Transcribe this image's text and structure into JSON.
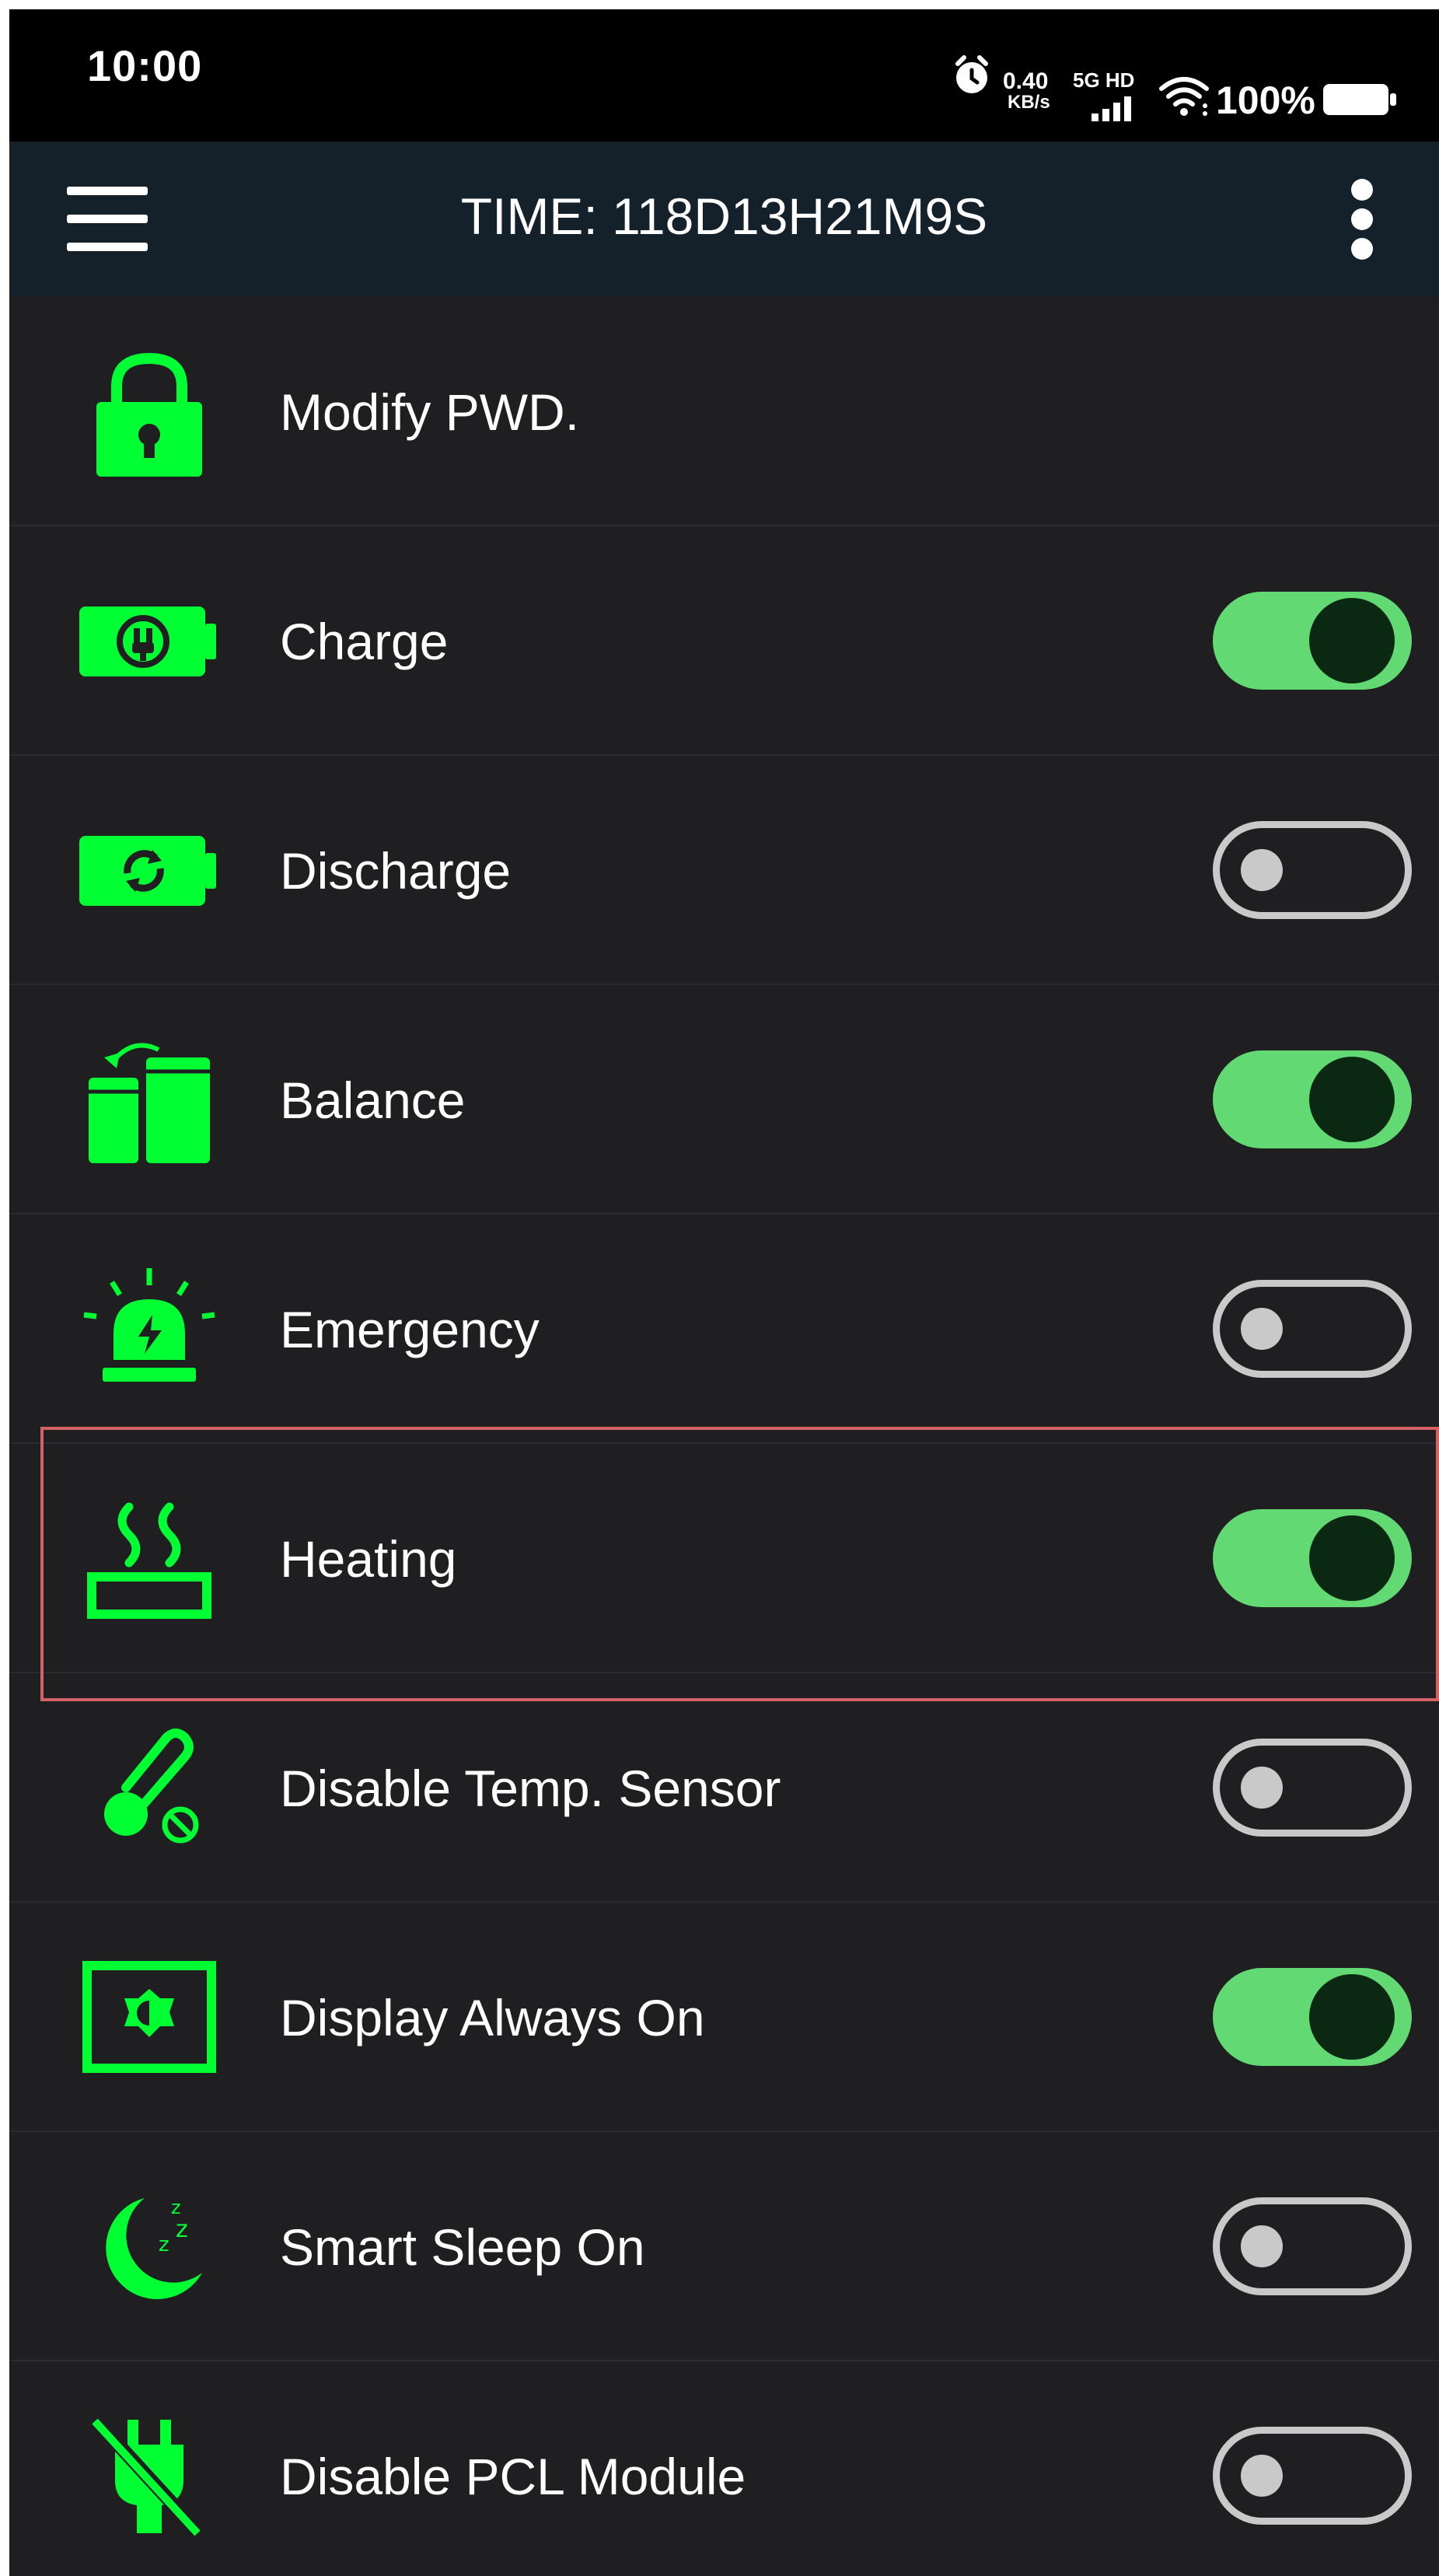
{
  "status_bar": {
    "time": "10:00",
    "net_speed_value": "0.40",
    "net_speed_unit": "KB/s",
    "network_label": "5G HD",
    "battery_percent": "100%",
    "icons": [
      "alarm-icon",
      "signal-icon",
      "wifi-icon",
      "battery-icon"
    ]
  },
  "app_bar": {
    "title": "TIME: 118D13H21M9S",
    "icons": [
      "hamburger-menu-icon",
      "more-vert-icon"
    ]
  },
  "colors": {
    "accent_green": "#00ff33",
    "toggle_on": "#63d974",
    "toggle_knob_on": "#0b2912",
    "toggle_off": "#c9c9c9",
    "background": "#1f1f22",
    "app_bar": "#14202a",
    "highlight": "#d46266"
  },
  "settings": [
    {
      "label": "Modify PWD.",
      "icon": "lock-icon"
    },
    {
      "label": "Charge",
      "icon": "battery-charge-icon",
      "toggle": true
    },
    {
      "label": "Discharge",
      "icon": "battery-discharge-icon",
      "toggle": false
    },
    {
      "label": "Balance",
      "icon": "balance-cells-icon",
      "toggle": true
    },
    {
      "label": "Emergency",
      "icon": "emergency-beacon-icon",
      "toggle": false
    },
    {
      "label": "Heating",
      "icon": "heating-icon",
      "toggle": true,
      "highlighted": true
    },
    {
      "label": "Disable Temp. Sensor",
      "icon": "thermometer-disabled-icon",
      "toggle": false
    },
    {
      "label": "Display Always On",
      "icon": "display-brightness-icon",
      "toggle": true
    },
    {
      "label": "Smart Sleep On",
      "icon": "moon-sleep-icon",
      "toggle": false
    },
    {
      "label": "Disable PCL Module",
      "icon": "plug-disabled-icon",
      "toggle": false
    }
  ]
}
